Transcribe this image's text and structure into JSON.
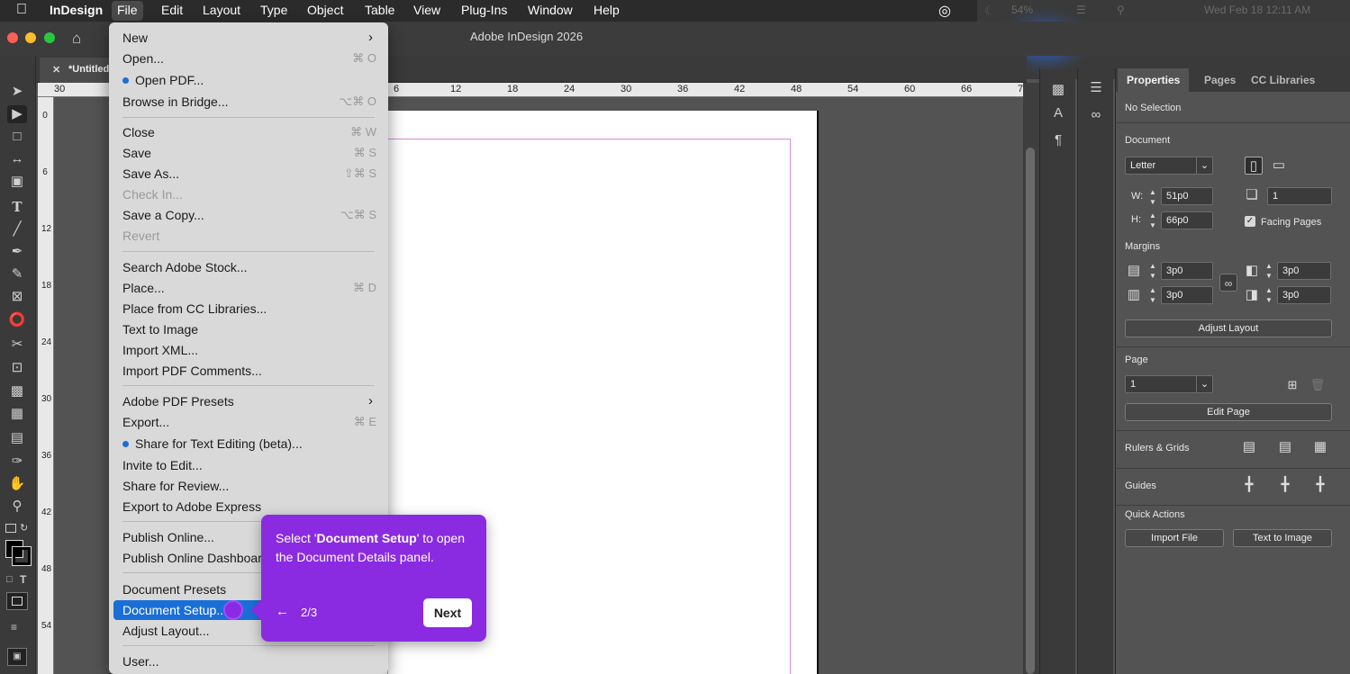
{
  "menubar": {
    "app": "InDesign",
    "items": [
      "File",
      "Edit",
      "Layout",
      "Type",
      "Object",
      "Table",
      "View",
      "Plug-Ins",
      "Window",
      "Help"
    ],
    "battery": "54%",
    "datetime": "Wed Feb 18  12:11 AM"
  },
  "window": {
    "title": "Adobe InDesign 2026",
    "doc_tab": "*Untitled"
  },
  "ruler": {
    "h_ticks": [
      "30",
      "6",
      "12",
      "18",
      "24",
      "30",
      "36",
      "42",
      "48",
      "54",
      "60",
      "66",
      "7"
    ],
    "v_ticks": [
      "0",
      "6",
      "12",
      "18",
      "24",
      "30",
      "36",
      "42",
      "48",
      "54"
    ]
  },
  "file_menu": {
    "items": [
      {
        "label": "New",
        "submenu": true
      },
      {
        "label": "Open...",
        "shortcut": "⌘ O"
      },
      {
        "label": "Open PDF...",
        "dot": true
      },
      {
        "label": "Browse in Bridge...",
        "shortcut": "⌥⌘ O"
      },
      {
        "label": "Close",
        "shortcut": "⌘ W"
      },
      {
        "label": "Save",
        "shortcut": "⌘ S"
      },
      {
        "label": "Save As...",
        "shortcut": "⇧⌘ S"
      },
      {
        "label": "Check In...",
        "disabled": true
      },
      {
        "label": "Save a Copy...",
        "shortcut": "⌥⌘ S"
      },
      {
        "label": "Revert",
        "disabled": true
      },
      {
        "label": "Search Adobe Stock..."
      },
      {
        "label": "Place...",
        "shortcut": "⌘ D"
      },
      {
        "label": "Place from CC Libraries..."
      },
      {
        "label": "Text to Image"
      },
      {
        "label": "Import XML..."
      },
      {
        "label": "Import PDF Comments..."
      },
      {
        "label": "Adobe PDF Presets",
        "submenu": true
      },
      {
        "label": "Export...",
        "shortcut": "⌘ E"
      },
      {
        "label": "Share for Text Editing (beta)...",
        "dot": true
      },
      {
        "label": "Invite to Edit..."
      },
      {
        "label": "Share for Review..."
      },
      {
        "label": "Export to Adobe Express"
      },
      {
        "label": "Publish Online..."
      },
      {
        "label": "Publish Online Dashboard..."
      },
      {
        "label": "Document Presets"
      },
      {
        "label": "Document Setup...",
        "selected": true
      },
      {
        "label": "Adjust Layout..."
      },
      {
        "label": "User..."
      }
    ]
  },
  "tooltip": {
    "text_before": "Select '",
    "text_bold": "Document Setup",
    "text_after": "' to open the Document Details panel.",
    "step": "2/3",
    "next_label": "Next",
    "back_glyph": "←"
  },
  "properties": {
    "tabs": [
      "Properties",
      "Pages",
      "CC Libraries"
    ],
    "selection": "No Selection",
    "document_heading": "Document",
    "preset": "Letter",
    "width_label": "W:",
    "width": "51p0",
    "height_label": "H:",
    "height": "66p0",
    "pages_count": "1",
    "facing_pages": "Facing Pages",
    "margins_heading": "Margins",
    "margin_top": "3p0",
    "margin_bottom": "3p0",
    "margin_inside": "3p0",
    "margin_outside": "3p0",
    "adjust_layout": "Adjust Layout",
    "page_heading": "Page",
    "page_value": "1",
    "edit_page": "Edit Page",
    "rulers_grids": "Rulers & Grids",
    "guides": "Guides",
    "quick_actions": "Quick Actions",
    "import_file": "Import File",
    "text_to_image": "Text to Image"
  },
  "colors": {
    "accent_purple": "#8a2be2",
    "selection_blue": "#1a6fd6",
    "margin_guide": "#d88ad8"
  }
}
